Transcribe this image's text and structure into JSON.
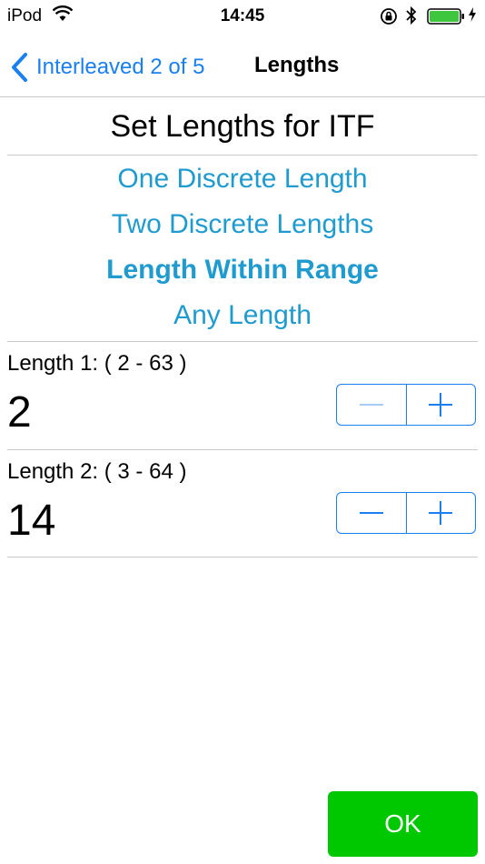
{
  "status_bar": {
    "carrier": "iPod",
    "time": "14:45",
    "icons": [
      "wifi-icon",
      "orientation-lock-icon",
      "bluetooth-icon",
      "battery-icon",
      "charging-bolt-icon"
    ]
  },
  "nav": {
    "back_label": "Interleaved 2 of 5",
    "title": "Lengths"
  },
  "section_title": "Set Lengths for ITF",
  "options": [
    {
      "label": "One Discrete Length"
    },
    {
      "label": "Two Discrete Lengths"
    },
    {
      "label": "Length Within Range",
      "selected": true
    },
    {
      "label": "Any Length"
    }
  ],
  "length1": {
    "label": "Length 1: ( 2 - 63 )",
    "value": "2",
    "minus_enabled": false
  },
  "length2": {
    "label": "Length 2: ( 3 - 64 )",
    "value": "14",
    "minus_enabled": true
  },
  "ok_label": "OK",
  "colors": {
    "accent": "#1a7ff0",
    "option": "#1f9bcf",
    "ok": "#00c800",
    "disabled": "#a9ccf5"
  }
}
